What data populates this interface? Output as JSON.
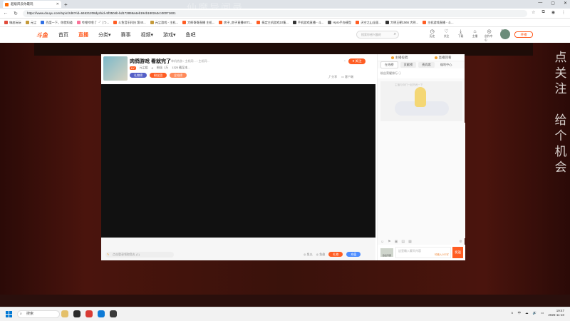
{
  "browser": {
    "tab_title": "超级风云你最玩",
    "url": "https://www.douyu.com/topic/zd6?rid=94621208dyshid=5f3504b-bd172859a4eb194b1802a3cc00071601",
    "overlay_text": "仙魔异闻录"
  },
  "bookmarks": [
    {
      "label": "嗨皮玩玩",
      "color": "#e04b3a"
    },
    {
      "label": "元尘",
      "color": "#c49a3a"
    },
    {
      "label": "百度一下，你就知道",
      "color": "#2f6fe4"
    },
    {
      "label": "哔哩哔哩 (゜-゜)つ...",
      "color": "#fb7299"
    },
    {
      "label": "斗鱼音乐科技 第40...",
      "color": "#ff5d23"
    },
    {
      "label": "元尘游戏 - 主机...",
      "color": "#c49a3a"
    },
    {
      "label": "大辉哥哥直播 主机...",
      "color": "#ff5d23"
    },
    {
      "label": "房子_房子直播6071...",
      "color": "#ff5d23"
    },
    {
      "label": "搞定主机游戏10集...",
      "color": "#ff5d23"
    },
    {
      "label": "手机游戏直播 - 斗...",
      "color": "#333333"
    },
    {
      "label": "Hpro手办模型",
      "color": "#666666"
    },
    {
      "label": "天空之山全面...",
      "color": "#ff5d23"
    },
    {
      "label": "大明王朝1566 大明...",
      "color": "#333333"
    },
    {
      "label": "主机游戏直播 - 斗...",
      "color": "#ff5d23"
    }
  ],
  "site": {
    "logo": "斗鱼",
    "nav": [
      "首页",
      "直播",
      "分类▾",
      "赛事",
      "视频▾",
      "游戏▾",
      "鱼吧"
    ],
    "search_placeholder": "搜索你感兴趣的",
    "icons": [
      {
        "glyph": "◷",
        "label": "历史"
      },
      {
        "glyph": "♡",
        "label": "关注"
      },
      {
        "glyph": "⤓",
        "label": "下载"
      },
      {
        "glyph": "⌂",
        "label": "主播"
      },
      {
        "glyph": "◎",
        "label": "创作中心"
      },
      {
        "glyph": "▣",
        "label": "任务"
      }
    ],
    "open_label": "开播"
  },
  "room": {
    "title": "肉鸽游戏 看就完了",
    "sub": "单机热游 › 主机同... › 主机同...",
    "level": "LV",
    "streamer": "元尘姐",
    "fans": "0",
    "heat": "粉丝: 1万",
    "rank": "1320 截至本...",
    "badges": [
      {
        "label": "礼物榜",
        "color": "#5560c7"
      },
      {
        "label": "粉丝团",
        "color": "#ff5d23"
      },
      {
        "label": "全站榜",
        "color": "#ff8a5a"
      }
    ],
    "follow_label": "♥ 关注",
    "share_label": "分享",
    "client_label": "客户端"
  },
  "player_bar": {
    "fish_input": "点击登录领取鱼丸 (1)",
    "speed_label": "鱼丸",
    "fish_label": "鱼翅",
    "gift_label": "礼物",
    "recharge_label": "充值"
  },
  "chat": {
    "top_tabs": [
      "主播投稿",
      "直播回看"
    ],
    "tabs": [
      "在线榜",
      "贡献榜",
      "贵宾席",
      "福利中心"
    ],
    "fans_bar": "粉丝荣耀排行 ⓘ",
    "mascot_text": "主播与你们一起热闹一下",
    "input_placeholder": "这里输入聊天内容",
    "input_limit": "可输入100字",
    "send_label": "发送",
    "mini_av_label": "欧皇专属"
  },
  "side_text": [
    "点",
    "关",
    "注",
    "",
    "给",
    "个",
    "机",
    "会"
  ],
  "taskbar": {
    "search_label": "搜索",
    "apps": [
      "#e4c06a",
      "#2a2a2a",
      "#d83b35",
      "#0f7bd6",
      "#3a3a3a"
    ],
    "tray_items": [
      "∧",
      "中",
      "☁",
      "🔊",
      "▭"
    ],
    "time": "19:47",
    "date": "2025-11-10"
  }
}
